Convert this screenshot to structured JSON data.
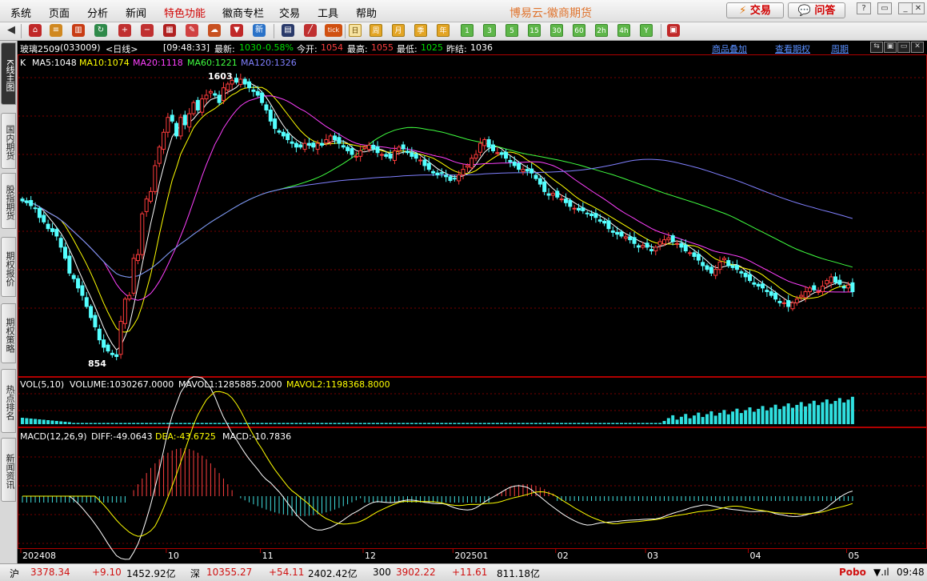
{
  "menu": [
    "系统",
    "页面",
    "分析",
    "新闻",
    "特色功能",
    "徽商专栏",
    "交易",
    "工具",
    "帮助"
  ],
  "app_title": "博易云-徽商期货",
  "trade_button": "交易",
  "ask_button": "问答",
  "period_buttons": [
    "日",
    "周",
    "月",
    "季",
    "年",
    "1",
    "3",
    "5",
    "15",
    "30",
    "60",
    "2h",
    "4h",
    "Y"
  ],
  "side_tabs": [
    "K线主图",
    "国内期货",
    "股指期货",
    "期权报价",
    "期权策略",
    "热点排名",
    "新闻资讯"
  ],
  "info": {
    "symbol": "玻璃2509",
    "code": "(033009)",
    "period": "<日线>",
    "time": "[09:48:33]",
    "latest_label": "最新:",
    "latest": "1030",
    "change": "-0.58%",
    "open_label": "今开:",
    "open": "1054",
    "high_label": "最高:",
    "high": "1055",
    "low_label": "最低:",
    "low": "1025",
    "prev_label": "昨结:",
    "prev": "1036",
    "link_overlay": "商品叠加",
    "link_options": "查看期权",
    "link_period": "周期"
  },
  "ma_legend": {
    "k": "K",
    "ma5": "MA5:1048",
    "ma10": "MA10:1074",
    "ma20": "MA20:1118",
    "ma60": "MA60:1221",
    "ma120": "MA120:1326"
  },
  "vol_legend": {
    "label": "VOL(5,10)",
    "volume": "VOLUME:1030267.0000",
    "mavol1": "MAVOL1:1285885.2000",
    "mavol2": "MAVOL2:1198368.8000"
  },
  "macd_legend": {
    "label": "MACD(12,26,9)",
    "diff": "DIFF:-49.0643",
    "dea": "DEA:-43.6725",
    "macd": "MACD:-10.7836"
  },
  "chart_data": {
    "type": "candlestick",
    "annotations": {
      "high": "1603",
      "low": "854"
    },
    "x_ticks": [
      {
        "label": "202408",
        "i": 0
      },
      {
        "label": "10",
        "i": 34
      },
      {
        "label": "11",
        "i": 56
      },
      {
        "label": "12",
        "i": 80
      },
      {
        "label": "202501",
        "i": 101
      },
      {
        "label": "02",
        "i": 125
      },
      {
        "label": "03",
        "i": 146
      },
      {
        "label": "04",
        "i": 170
      },
      {
        "label": "05",
        "i": 193
      }
    ],
    "close_series": [
      1275,
      1270,
      1262,
      1255,
      1230,
      1218,
      1200,
      1192,
      1180,
      1150,
      1120,
      1080,
      1065,
      1040,
      1020,
      990,
      960,
      935,
      900,
      880,
      870,
      860,
      855,
      950,
      1010,
      1020,
      1120,
      1130,
      1240,
      1280,
      1300,
      1370,
      1420,
      1460,
      1500,
      1490,
      1450,
      1500,
      1480,
      1510,
      1540,
      1520,
      1550,
      1560,
      1570,
      1560,
      1540,
      1580,
      1590,
      1600,
      1595,
      1603,
      1590,
      1580,
      1570,
      1560,
      1540,
      1520,
      1490,
      1470,
      1460,
      1450,
      1440,
      1430,
      1420,
      1420,
      1430,
      1425,
      1420,
      1430,
      1425,
      1440,
      1450,
      1440,
      1430,
      1420,
      1410,
      1400,
      1395,
      1410,
      1420,
      1425,
      1415,
      1405,
      1400,
      1395,
      1390,
      1410,
      1420,
      1415,
      1405,
      1395,
      1390,
      1385,
      1370,
      1360,
      1350,
      1345,
      1350,
      1340,
      1330,
      1335,
      1345,
      1360,
      1370,
      1390,
      1400,
      1430,
      1440,
      1420,
      1410,
      1405,
      1400,
      1390,
      1380,
      1370,
      1360,
      1360,
      1355,
      1350,
      1335,
      1320,
      1300,
      1290,
      1295,
      1285,
      1280,
      1270,
      1260,
      1255,
      1250,
      1248,
      1240,
      1235,
      1230,
      1220,
      1215,
      1200,
      1190,
      1185,
      1180,
      1178,
      1170,
      1160,
      1150,
      1155,
      1150,
      1140,
      1150,
      1165,
      1170,
      1175,
      1165,
      1160,
      1150,
      1140,
      1135,
      1125,
      1115,
      1100,
      1090,
      1080,
      1090,
      1110,
      1120,
      1100,
      1095,
      1090,
      1080,
      1070,
      1060,
      1050,
      1045,
      1040,
      1030,
      1020,
      1010,
      1000,
      1000,
      990,
      1000,
      1010,
      1020,
      1030,
      1040,
      1035,
      1030,
      1045,
      1060,
      1070,
      1055,
      1050,
      1040,
      1048,
      1030
    ],
    "ma20_hint": "",
    "volume_scale": "",
    "macd_scale": ""
  }
}
